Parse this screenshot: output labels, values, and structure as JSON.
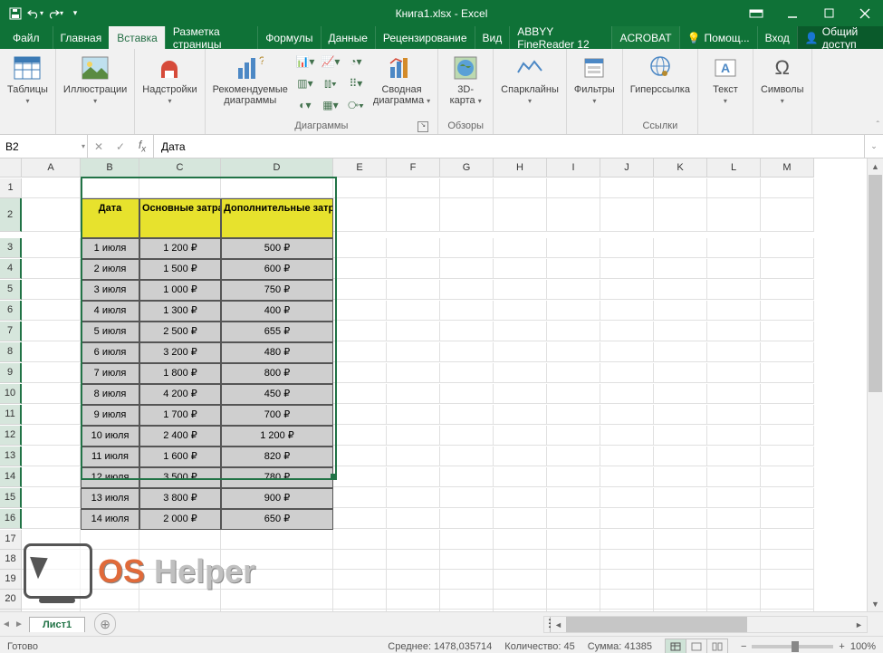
{
  "title": "Книга1.xlsx - Excel",
  "menu": {
    "file": "Файл",
    "home": "Главная",
    "insert": "Вставка",
    "layout": "Разметка страницы",
    "formulas": "Формулы",
    "data": "Данные",
    "review": "Рецензирование",
    "view": "Вид",
    "abbyy": "ABBYY FineReader 12",
    "acrobat": "ACROBAT",
    "help": "Помощ...",
    "signin": "Вход",
    "share": "Общий доступ"
  },
  "ribbon": {
    "tables": "Таблицы",
    "illustrations": "Иллюстрации",
    "addins": "Надстройки",
    "rec_charts": "Рекомендуемые\nдиаграммы",
    "charts_group": "Диаграммы",
    "pivotchart": "Сводная\nдиаграмма",
    "map3d": "3D-\nкарта",
    "tours_group": "Обзоры",
    "sparklines": "Спарклайны",
    "filters": "Фильтры",
    "hyperlink": "Гиперссылка",
    "links_group": "Ссылки",
    "text": "Текст",
    "symbols": "Символы"
  },
  "namebox": "B2",
  "formula": "Дата",
  "columns": [
    "",
    "A",
    "B",
    "C",
    "D",
    "E",
    "F",
    "G",
    "H",
    "I",
    "J",
    "K",
    "L",
    "M"
  ],
  "table": {
    "head": [
      "Дата",
      "Основные затраты",
      "Дополнительные затраты"
    ],
    "rows": [
      [
        "1 июля",
        "1 200 ₽",
        "500 ₽"
      ],
      [
        "2 июля",
        "1 500 ₽",
        "600 ₽"
      ],
      [
        "3 июля",
        "1 000 ₽",
        "750 ₽"
      ],
      [
        "4 июля",
        "1 300 ₽",
        "400 ₽"
      ],
      [
        "5 июля",
        "2 500 ₽",
        "655 ₽"
      ],
      [
        "6 июля",
        "3 200 ₽",
        "480 ₽"
      ],
      [
        "7 июля",
        "1 800 ₽",
        "800 ₽"
      ],
      [
        "8 июля",
        "4 200 ₽",
        "450 ₽"
      ],
      [
        "9 июля",
        "1 700 ₽",
        "700 ₽"
      ],
      [
        "10 июля",
        "2 400 ₽",
        "1 200 ₽"
      ],
      [
        "11 июля",
        "1 600 ₽",
        "820 ₽"
      ],
      [
        "12 июля",
        "3 500 ₽",
        "780 ₽"
      ],
      [
        "13 июля",
        "3 800 ₽",
        "900 ₽"
      ],
      [
        "14 июля",
        "2 000 ₽",
        "650 ₽"
      ]
    ]
  },
  "sheet_tab": "Лист1",
  "status": {
    "ready": "Готово",
    "avg": "Среднее: 1478,035714",
    "count": "Количество: 45",
    "sum": "Сумма: 41385",
    "zoom": "100%"
  },
  "watermark": {
    "os": "OS",
    "helper": "Helper"
  }
}
